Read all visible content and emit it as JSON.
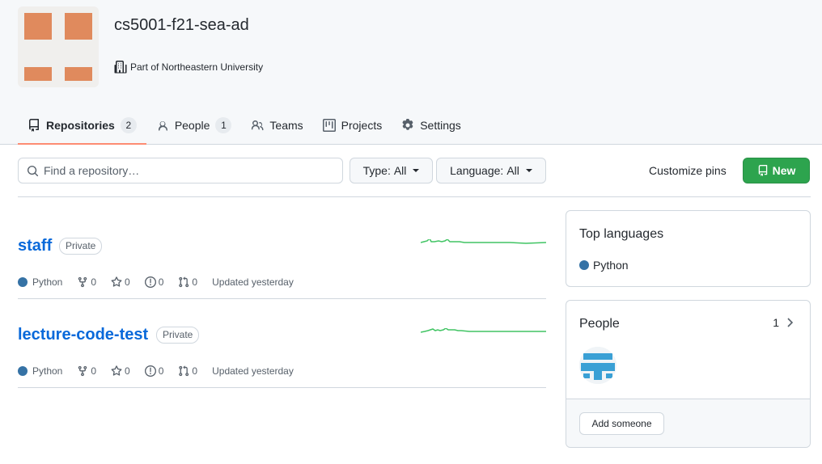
{
  "org": {
    "name": "cs5001-f21-sea-ad",
    "affiliation": "Part of Northeastern University",
    "avatar_color": "#e08a5d"
  },
  "tabs": [
    {
      "label": "Repositories",
      "count": "2",
      "icon": "repo-icon",
      "selected": true
    },
    {
      "label": "People",
      "count": "1",
      "icon": "person-icon"
    },
    {
      "label": "Teams",
      "icon": "people-icon"
    },
    {
      "label": "Projects",
      "icon": "project-icon"
    },
    {
      "label": "Settings",
      "icon": "gear-icon"
    }
  ],
  "toolbar": {
    "search_placeholder": "Find a repository…",
    "type_label": "Type:",
    "type_value": "All",
    "language_label": "Language:",
    "language_value": "All",
    "customize_pins": "Customize pins",
    "new_label": "New"
  },
  "repos": [
    {
      "name": "staff",
      "visibility": "Private",
      "language": "Python",
      "forks": "0",
      "stars": "0",
      "issues": "0",
      "pulls": "0",
      "updated": "Updated yesterday"
    },
    {
      "name": "lecture-code-test",
      "visibility": "Private",
      "language": "Python",
      "forks": "0",
      "stars": "0",
      "issues": "0",
      "pulls": "0",
      "updated": "Updated yesterday"
    }
  ],
  "sidebar": {
    "top_languages_title": "Top languages",
    "top_language": "Python",
    "language_color": "#3572A5",
    "people_title": "People",
    "people_count": "1",
    "add_someone": "Add someone"
  },
  "colors": {
    "accent_green": "#2da44e",
    "link_blue": "#0969da",
    "tab_underline": "#fd8c73",
    "sparkline": "#40c463"
  }
}
